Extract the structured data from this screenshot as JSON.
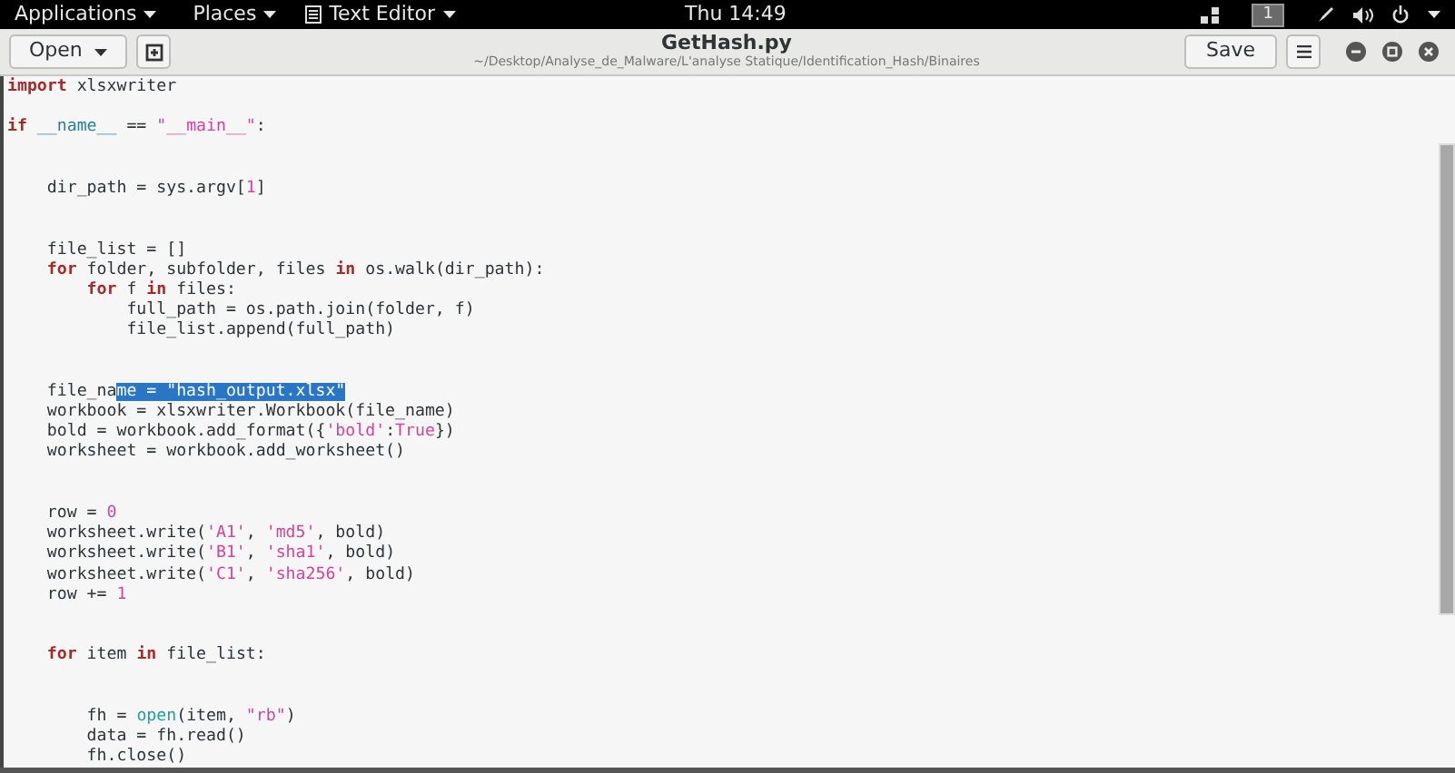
{
  "top_bar": {
    "menus": [
      {
        "label": "Applications",
        "kind": "menu"
      },
      {
        "label": "Places",
        "kind": "menu"
      },
      {
        "label": "Text Editor",
        "kind": "app"
      }
    ],
    "clock": "Thu 14:49",
    "workspace": "1"
  },
  "header": {
    "open_button": "Open",
    "title": "GetHash.py",
    "subtitle": "~/Desktop/Analyse_de_Malware/L'analyse Statique/Identification_Hash/Binaires",
    "save_button": "Save"
  },
  "editor": {
    "lines": [
      {
        "kind": "code",
        "tokens": [
          {
            "kind": "keyword",
            "text": "import"
          },
          {
            "kind": "plain",
            "text": " xlsxwriter"
          }
        ]
      },
      {
        "kind": "blank"
      },
      {
        "kind": "code",
        "tokens": [
          {
            "kind": "keyword",
            "text": "if"
          },
          {
            "kind": "special",
            "text": " __name__"
          },
          {
            "kind": "plain",
            "text": " == "
          },
          {
            "kind": "string",
            "text": "\"__main__\""
          },
          {
            "kind": "plain",
            "text": ":"
          }
        ]
      },
      {
        "kind": "blank"
      },
      {
        "kind": "blank"
      },
      {
        "kind": "code",
        "tokens": [
          {
            "kind": "plain",
            "text": "    dir_path = sys.argv["
          },
          {
            "kind": "number",
            "text": "1"
          },
          {
            "kind": "plain",
            "text": "]"
          }
        ]
      },
      {
        "kind": "blank"
      },
      {
        "kind": "blank"
      },
      {
        "kind": "code",
        "tokens": [
          {
            "kind": "plain",
            "text": "    file_list = []"
          }
        ]
      },
      {
        "kind": "code",
        "tokens": [
          {
            "kind": "keyword",
            "text": "    for"
          },
          {
            "kind": "plain",
            "text": " folder, subfolder, files "
          },
          {
            "kind": "keyword",
            "text": "in"
          },
          {
            "kind": "plain",
            "text": " os.walk(dir_path):"
          }
        ]
      },
      {
        "kind": "code",
        "tokens": [
          {
            "kind": "keyword",
            "text": "        for"
          },
          {
            "kind": "plain",
            "text": " f "
          },
          {
            "kind": "keyword",
            "text": "in"
          },
          {
            "kind": "plain",
            "text": " files:"
          }
        ]
      },
      {
        "kind": "code",
        "tokens": [
          {
            "kind": "plain",
            "text": "            full_path = os.path.join(folder, f)"
          }
        ]
      },
      {
        "kind": "code",
        "tokens": [
          {
            "kind": "plain",
            "text": "            file_list.append(full_path)"
          }
        ]
      },
      {
        "kind": "blank"
      },
      {
        "kind": "blank"
      },
      {
        "kind": "code",
        "tokens": [
          {
            "kind": "plain",
            "text": "    file_na"
          },
          {
            "kind": "selected",
            "text": "me = \"hash_output.xlsx\""
          }
        ]
      },
      {
        "kind": "code",
        "tokens": [
          {
            "kind": "plain",
            "text": "    workbook = xlsxwriter.Workbook(file_name)"
          }
        ]
      },
      {
        "kind": "code",
        "tokens": [
          {
            "kind": "plain",
            "text": "    bold = workbook.add_format({"
          },
          {
            "kind": "string",
            "text": "'bold'"
          },
          {
            "kind": "plain",
            "text": ":"
          },
          {
            "kind": "number",
            "text": "True"
          },
          {
            "kind": "plain",
            "text": "})"
          }
        ]
      },
      {
        "kind": "code",
        "tokens": [
          {
            "kind": "plain",
            "text": "    worksheet = workbook.add_worksheet()"
          }
        ]
      },
      {
        "kind": "blank"
      },
      {
        "kind": "blank"
      },
      {
        "kind": "code",
        "tokens": [
          {
            "kind": "plain",
            "text": "    row = "
          },
          {
            "kind": "number",
            "text": "0"
          }
        ]
      },
      {
        "kind": "code",
        "tokens": [
          {
            "kind": "plain",
            "text": "    worksheet.write("
          },
          {
            "kind": "string",
            "text": "'A1'"
          },
          {
            "kind": "plain",
            "text": ", "
          },
          {
            "kind": "string",
            "text": "'md5'"
          },
          {
            "kind": "plain",
            "text": ", bold)"
          }
        ]
      },
      {
        "kind": "code",
        "tokens": [
          {
            "kind": "plain",
            "text": "    worksheet.write("
          },
          {
            "kind": "string",
            "text": "'B1'"
          },
          {
            "kind": "plain",
            "text": ", "
          },
          {
            "kind": "string",
            "text": "'sha1'"
          },
          {
            "kind": "plain",
            "text": ", bold)"
          }
        ]
      },
      {
        "kind": "code",
        "tokens": [
          {
            "kind": "plain",
            "text": "    worksheet.write("
          },
          {
            "kind": "string",
            "text": "'C1'"
          },
          {
            "kind": "plain",
            "text": ", "
          },
          {
            "kind": "string",
            "text": "'sha256'"
          },
          {
            "kind": "plain",
            "text": ", bold)"
          }
        ]
      },
      {
        "kind": "code",
        "tokens": [
          {
            "kind": "plain",
            "text": "    row += "
          },
          {
            "kind": "number",
            "text": "1"
          }
        ]
      },
      {
        "kind": "blank"
      },
      {
        "kind": "blank"
      },
      {
        "kind": "code",
        "tokens": [
          {
            "kind": "keyword",
            "text": "    for"
          },
          {
            "kind": "plain",
            "text": " item "
          },
          {
            "kind": "keyword",
            "text": "in"
          },
          {
            "kind": "plain",
            "text": " file_list:"
          }
        ]
      },
      {
        "kind": "blank"
      },
      {
        "kind": "blank"
      },
      {
        "kind": "code",
        "tokens": [
          {
            "kind": "plain",
            "text": "        fh = "
          },
          {
            "kind": "builtin",
            "text": "open"
          },
          {
            "kind": "plain",
            "text": "(item, "
          },
          {
            "kind": "string",
            "text": "\"rb\""
          },
          {
            "kind": "plain",
            "text": ")"
          }
        ]
      },
      {
        "kind": "code",
        "tokens": [
          {
            "kind": "plain",
            "text": "        data = fh.read()"
          }
        ]
      },
      {
        "kind": "code",
        "tokens": [
          {
            "kind": "plain",
            "text": "        fh.close()"
          }
        ]
      }
    ]
  }
}
